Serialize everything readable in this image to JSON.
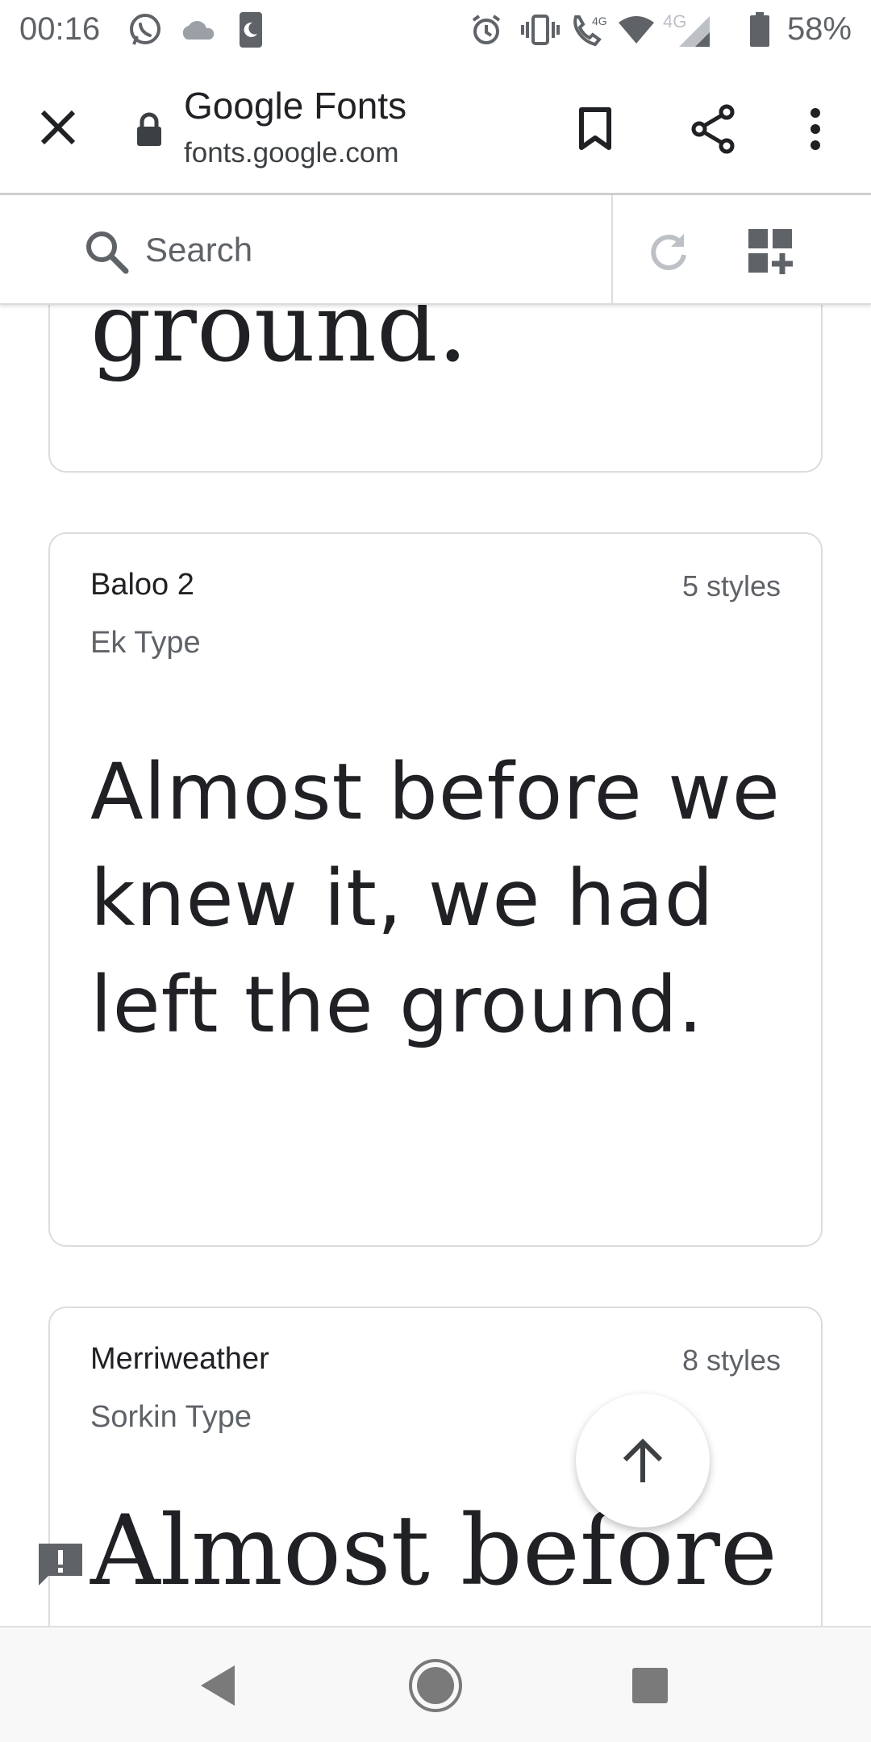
{
  "status_bar": {
    "time": "00:16",
    "network_label": "4G",
    "battery": "58%"
  },
  "browser": {
    "title": "Google Fonts",
    "url": "fonts.google.com"
  },
  "search": {
    "placeholder": "Search"
  },
  "cards": [
    {
      "sample": "ground."
    },
    {
      "family": "Baloo 2",
      "designer": "Ek Type",
      "styles": "5 styles",
      "sample": "Almost before we knew it, we had left the ground."
    },
    {
      "family": "Merriweather",
      "designer": "Sorkin Type",
      "styles": "8 styles",
      "sample": "Almost before"
    }
  ],
  "icons": {
    "close": "close-icon",
    "lock": "lock-icon",
    "bookmark": "bookmark-icon",
    "share": "share-icon",
    "more": "more-vert-icon",
    "search": "search-icon",
    "refresh": "refresh-icon",
    "add_collection": "add-to-collection-icon",
    "scroll_top": "arrow-up-icon",
    "feedback": "feedback-icon"
  },
  "colors": {
    "text_primary": "#202124",
    "text_secondary": "#5f6368",
    "border": "#dadce0"
  }
}
